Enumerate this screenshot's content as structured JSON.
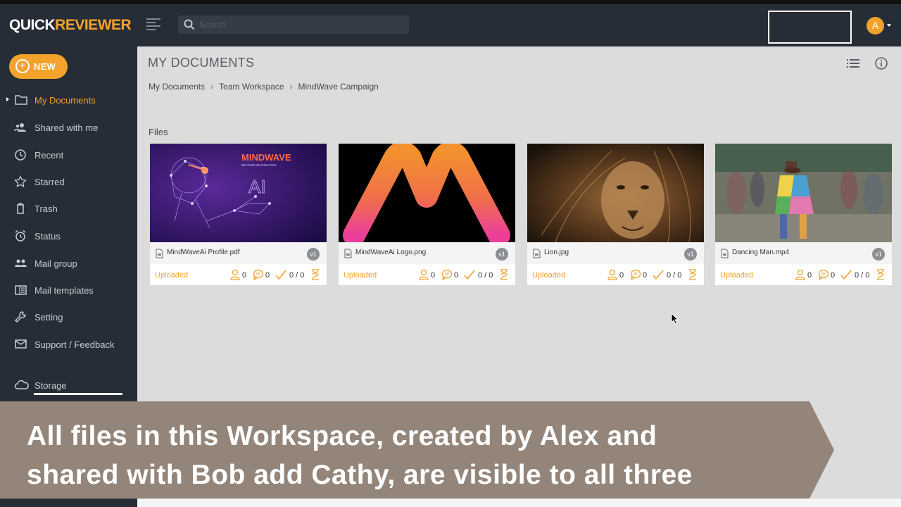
{
  "app": {
    "logo_part1": "QUICK",
    "logo_part2": "REVIEWER",
    "search_placeholder": "Search",
    "avatar_initial": "A",
    "accent_color": "#f3a32b",
    "sidebar_color": "#262d36"
  },
  "sidebar": {
    "new_label": "NEW",
    "items": [
      {
        "label": "My Documents",
        "icon": "folder-icon",
        "active": true
      },
      {
        "label": "Shared with me",
        "icon": "users-icon",
        "active": false
      },
      {
        "label": "Recent",
        "icon": "clock-icon",
        "active": false
      },
      {
        "label": "Starred",
        "icon": "star-icon",
        "active": false
      },
      {
        "label": "Trash",
        "icon": "trash-icon",
        "active": false
      },
      {
        "label": "Status",
        "icon": "alarm-icon",
        "active": false
      },
      {
        "label": "Mail group",
        "icon": "group-icon",
        "active": false
      },
      {
        "label": "Mail templates",
        "icon": "template-icon",
        "active": false
      },
      {
        "label": "Setting",
        "icon": "wrench-icon",
        "active": false
      },
      {
        "label": "Support / Feedback",
        "icon": "mail-icon",
        "active": false
      },
      {
        "label": "Storage",
        "icon": "cloud-icon",
        "active": false
      }
    ]
  },
  "main": {
    "title": "MY DOCUMENTS",
    "breadcrumb": [
      "My Documents",
      "Team Workspace",
      "MindWave Campaign"
    ],
    "files_label": "Files",
    "files": [
      {
        "name": "MindWaveAi Profile.pdf",
        "version": "v1",
        "status": "Uploaded",
        "reviewers": "0",
        "comments": "0",
        "approvals": "0 / 0"
      },
      {
        "name": "MindWaveAi Logo.png",
        "version": "v1",
        "status": "Uploaded",
        "reviewers": "0",
        "comments": "0",
        "approvals": "0 / 0"
      },
      {
        "name": "Lion.jpg",
        "version": "v1",
        "status": "Uploaded",
        "reviewers": "0",
        "comments": "0",
        "approvals": "0 / 0"
      },
      {
        "name": "Dancing Man.mp4",
        "version": "v1",
        "status": "Uploaded",
        "reviewers": "0",
        "comments": "0",
        "approvals": "0 / 0"
      }
    ],
    "thumb_texts": {
      "mindwave_logo": "MINDWAVE",
      "mindwave_tagline": "BEYOND IMAGINATION",
      "ai_text": "AI"
    }
  },
  "caption": {
    "line1": "All files in this Workspace, created by Alex and",
    "line2": "shared with Bob add Cathy, are visible to all three"
  }
}
